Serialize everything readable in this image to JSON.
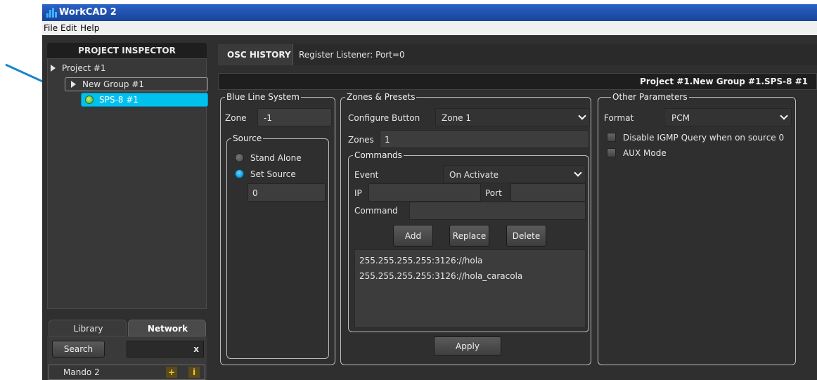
{
  "window": {
    "title": "WorkCAD 2"
  },
  "menu": [
    "File",
    "Edit",
    "Help"
  ],
  "inspector": {
    "title": "PROJECT INSPECTOR",
    "project": "Project #1",
    "group": "New Group #1",
    "device": "SPS-8 #1"
  },
  "bottom_tabs": {
    "library": "Library",
    "network": "Network"
  },
  "search": {
    "button": "Search",
    "clear": "x",
    "value": ""
  },
  "network_item": {
    "label": "Mando 2",
    "add": "+",
    "info": "i"
  },
  "osc": {
    "label": "OSC HISTORY",
    "text": "Register Listener: Port=0"
  },
  "path_bar": "Project #1.New Group #1.SPS-8 #1",
  "blue_line": {
    "legend": "Blue Line System",
    "zone_label": "Zone",
    "zone_value": "-1",
    "source": {
      "legend": "Source",
      "stand_alone": "Stand Alone",
      "set_source": "Set Source",
      "selected": "Set Source",
      "value": "0"
    }
  },
  "zones": {
    "legend": "Zones & Presets",
    "configure_label": "Configure Button",
    "configure_value": "Zone 1",
    "zones_label": "Zones",
    "zones_value": "1",
    "commands": {
      "legend": "Commands",
      "event_label": "Event",
      "event_value": "On Activate",
      "ip_label": "IP",
      "ip_value": "",
      "port_label": "Port",
      "port_value": "",
      "command_label": "Command",
      "command_value": "",
      "add": "Add",
      "replace": "Replace",
      "delete": "Delete",
      "list": [
        "255.255.255.255:3126://hola",
        "255.255.255.255:3126://hola_caracola"
      ]
    },
    "apply": "Apply"
  },
  "other": {
    "legend": "Other Parameters",
    "format_label": "Format",
    "format_value": "PCM",
    "disable_igmp": "Disable IGMP Query when on source 0",
    "aux_mode": "AUX Mode"
  },
  "colors": {
    "accent": "#18a5e6",
    "selection": "#00c0ee",
    "callout_line": "#1787c9",
    "title_bar": "#2459b8"
  },
  "icons": {
    "device": "green-device-icon"
  }
}
